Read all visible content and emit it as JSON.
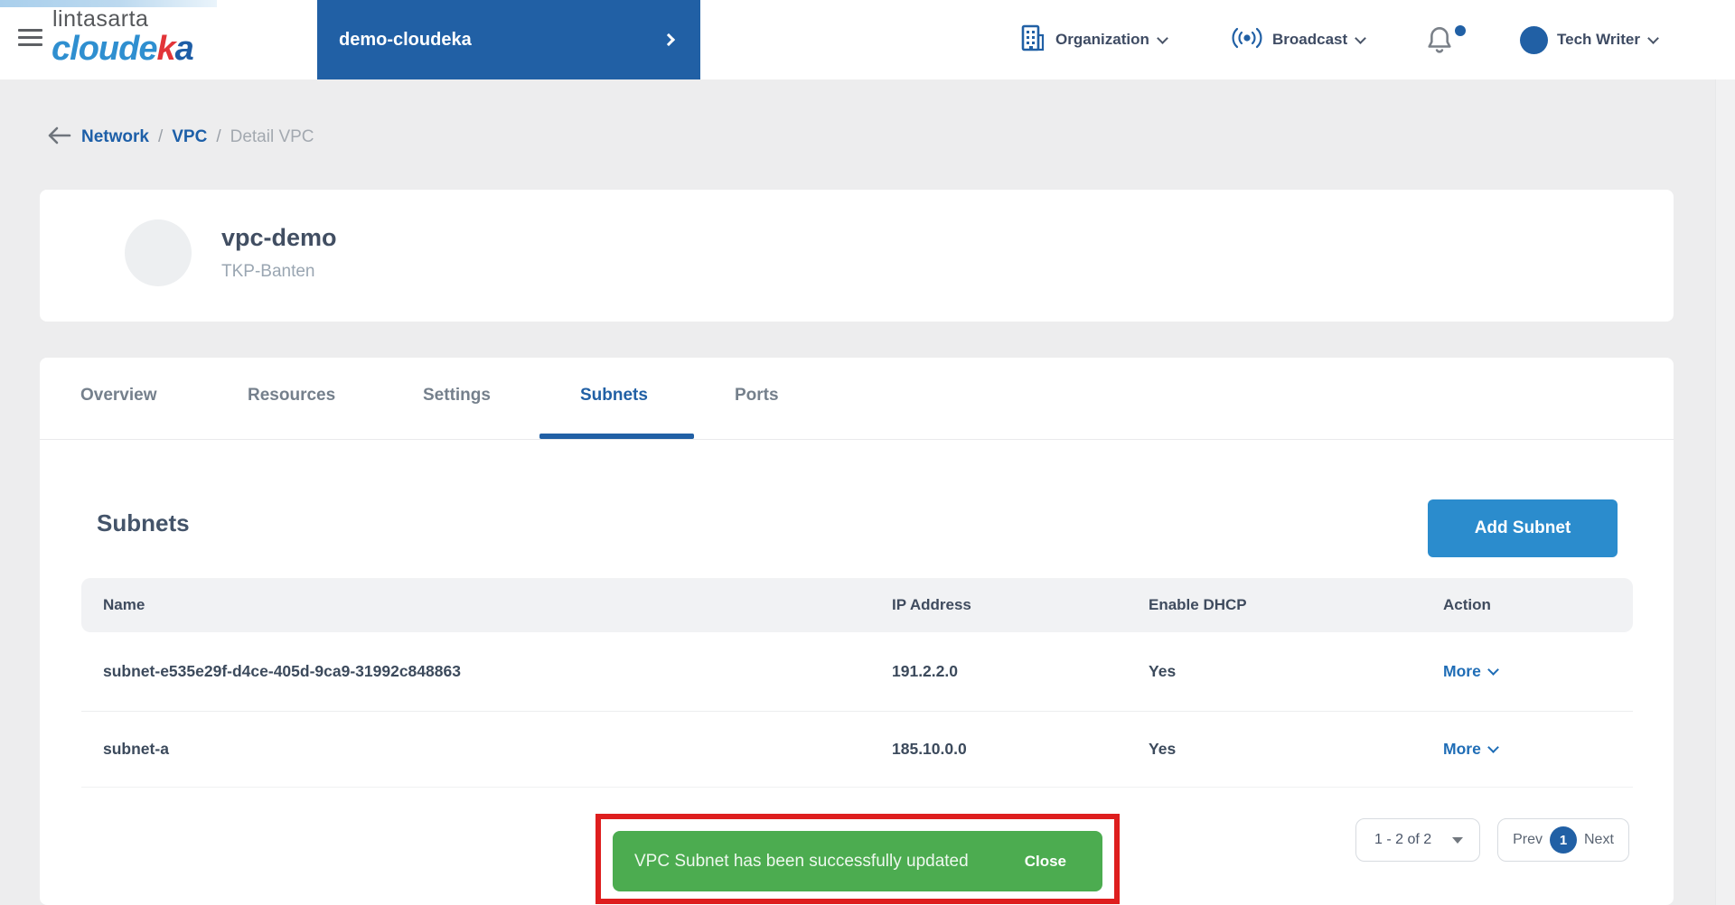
{
  "header": {
    "logo": {
      "company": "lintasarta",
      "brand_a": "cloude",
      "brand_b": "k",
      "brand_c": "a"
    },
    "project": {
      "name": "demo-cloudeka"
    },
    "menus": {
      "organization": "Organization",
      "broadcast": "Broadcast"
    },
    "user": {
      "name": "Tech Writer"
    }
  },
  "breadcrumb": {
    "separator": "/",
    "items": [
      {
        "label": "Network"
      },
      {
        "label": "VPC"
      },
      {
        "label": "Detail VPC"
      }
    ]
  },
  "vpc": {
    "name": "vpc-demo",
    "location": "TKP-Banten"
  },
  "tabs": {
    "active": "Subnets",
    "items": [
      {
        "label": "Overview"
      },
      {
        "label": "Resources"
      },
      {
        "label": "Settings"
      },
      {
        "label": "Subnets"
      },
      {
        "label": "Ports"
      }
    ]
  },
  "subnets": {
    "title": "Subnets",
    "add_button": "Add Subnet"
  },
  "table": {
    "columns": [
      {
        "label": "Name"
      },
      {
        "label": "IP Address"
      },
      {
        "label": "Enable DHCP"
      },
      {
        "label": "Action"
      }
    ],
    "rows": [
      {
        "name": "subnet-e535e29f-d4ce-405d-9ca9-31992c848863",
        "ip": "191.2.2.0",
        "dhcp": "Yes",
        "action": "More"
      },
      {
        "name": "subnet-a",
        "ip": "185.10.0.0",
        "dhcp": "Yes",
        "action": "More"
      }
    ]
  },
  "toast": {
    "message": "VPC Subnet has been successfully updated",
    "close": "Close"
  },
  "pagination": {
    "range": "1 - 2 of 2",
    "prev": "Prev",
    "current": "1",
    "next": "Next"
  },
  "colors": {
    "primary_blue": "#2160a5",
    "accent_blue": "#2b8ccd",
    "link_blue": "#1f6db6",
    "success_green": "#4cac50",
    "annotation_red": "#de1e1e",
    "brand_red": "#e23438",
    "brand_light_blue": "#2f8fd0"
  }
}
